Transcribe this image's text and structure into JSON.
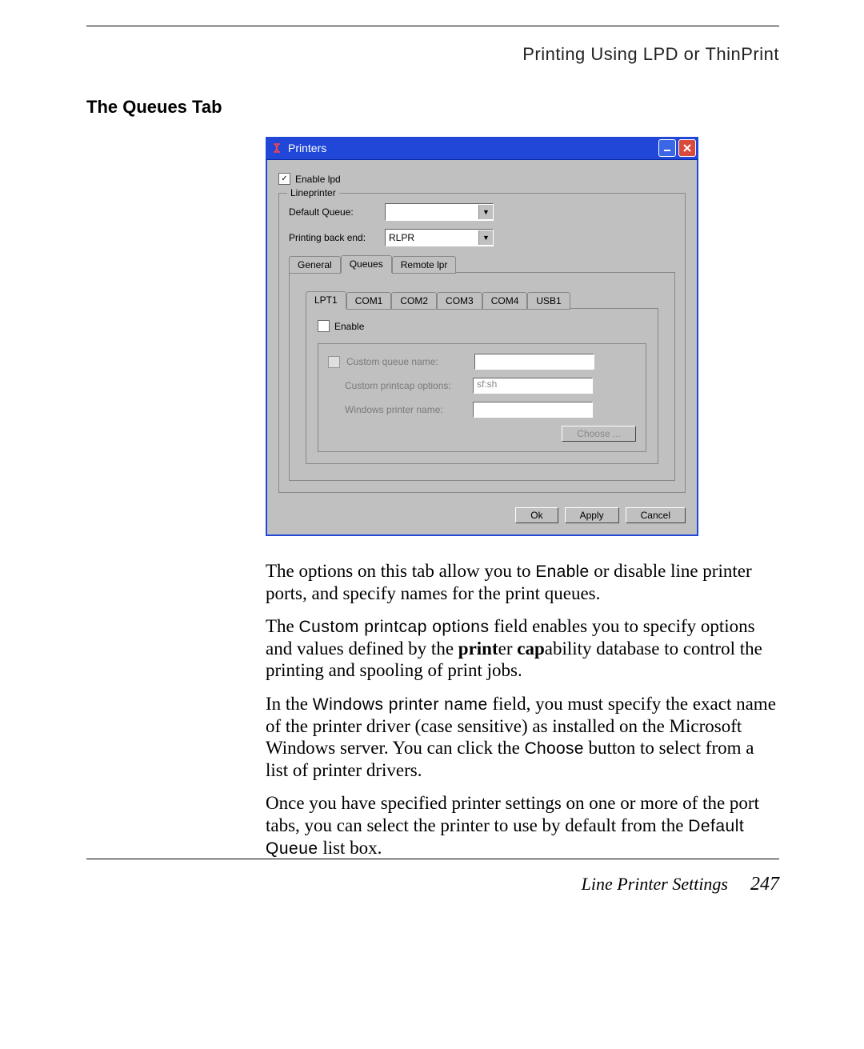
{
  "header": "Printing Using LPD or ThinPrint",
  "section_title": "The Queues Tab",
  "dialog": {
    "title": "Printers",
    "enable_lpd_label": "Enable lpd",
    "enable_lpd_checked": true,
    "lineprinter_legend": "Lineprinter",
    "default_queue_label": "Default Queue:",
    "default_queue_value": "",
    "backend_label": "Printing back end:",
    "backend_value": "RLPR",
    "tabs": {
      "general": "General",
      "queues": "Queues",
      "remote": "Remote lpr"
    },
    "port_tabs": [
      "LPT1",
      "COM1",
      "COM2",
      "COM3",
      "COM4",
      "USB1"
    ],
    "enable_port_label": "Enable",
    "custom_queue_label": "Custom queue name:",
    "custom_queue_value": "",
    "printcap_label": "Custom printcap options:",
    "printcap_value": "sf:sh",
    "winprinter_label": "Windows printer name:",
    "winprinter_value": "",
    "choose_label": "Choose ...",
    "ok_label": "Ok",
    "apply_label": "Apply",
    "cancel_label": "Cancel"
  },
  "body": {
    "p1a": "The options on this tab allow you to ",
    "p1b": "Enable",
    "p1c": " or disable line printer ports, and specify names for the print queues.",
    "p2a": "The ",
    "p2b": "Custom printcap options",
    "p2c": " field enables you to specify options and values defined by the ",
    "p2d": "print",
    "p2e": "er ",
    "p2f": "cap",
    "p2g": "ability database to control the printing and spooling of print jobs.",
    "p3a": "In the ",
    "p3b": "Windows printer name",
    "p3c": " field, you must specify the exact name of the printer driver (case sensitive) as installed on the Microsoft Windows server. You can click the ",
    "p3d": "Choose",
    "p3e": " button to select from a list of printer drivers.",
    "p4a": "Once you have specified printer settings on one or more of the port tabs, you can select the printer to use by default from the ",
    "p4b": "Default Queue",
    "p4c": " list box."
  },
  "footer": {
    "section": "Line Printer Settings",
    "page": "247"
  }
}
